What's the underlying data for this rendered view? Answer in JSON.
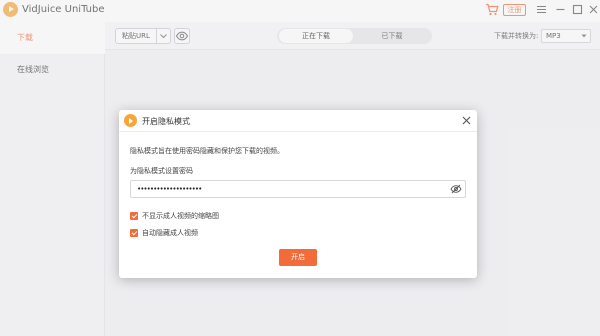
{
  "app": {
    "title": "VidJuice UniTube"
  },
  "titlebar": {
    "register_label": "注册"
  },
  "sidebar": {
    "items": [
      {
        "label": "下载",
        "active": true
      },
      {
        "label": "在线浏览",
        "active": false
      }
    ]
  },
  "toolbar": {
    "paste_url_label": "粘贴URL",
    "tabs": [
      {
        "label": "正在下载",
        "active": true
      },
      {
        "label": "已下载",
        "active": false
      }
    ],
    "convert_label": "下载并转换为:",
    "format_value": "MP3"
  },
  "dialog": {
    "title": "开启隐私模式",
    "description": "隐私模式旨在使用密码隐藏和保护您下载的视频。",
    "password_label": "为隐私模式设置密码",
    "password_value": "••••••••••••••••••••",
    "options": [
      {
        "label": "不显示成人视频的缩略图",
        "checked": true
      },
      {
        "label": "自动隐藏成人视频",
        "checked": true
      }
    ],
    "confirm_label": "开启"
  },
  "colors": {
    "accent": "#f26b3a",
    "logo": "#f7a53a"
  }
}
